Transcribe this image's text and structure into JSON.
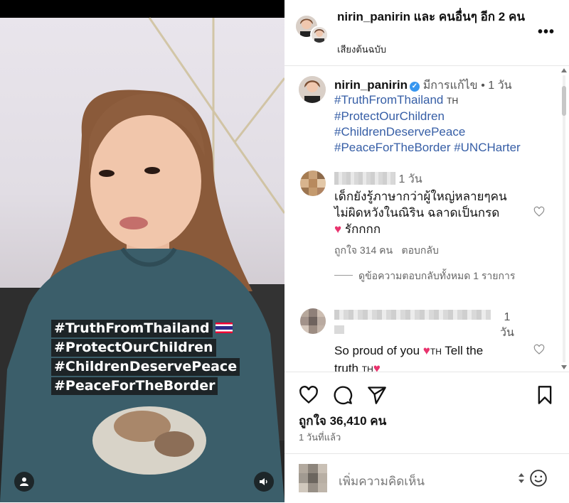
{
  "video": {
    "hashtags": [
      "#TruthFromThailand",
      "#ProtectOurChildren",
      "#ChildrenDeservePeace",
      "#PeaceForTheBorder"
    ],
    "flag_icon": "thailand-flag-icon"
  },
  "header": {
    "title": "nirin_panirin และ คนอื่นๆ อีก 2 คน",
    "audio": "เสียงต้นฉบับ",
    "more_icon": "more-icon"
  },
  "caption": {
    "username": "nirin_panirin",
    "edited": "มีการแก้ไข",
    "time": "1 วัน",
    "lines": [
      {
        "text": "#TruthFromThailand",
        "suffix": "TH"
      },
      {
        "text": "#ProtectOurChildren",
        "suffix": ""
      },
      {
        "text": "#ChildrenDeservePeace",
        "suffix": ""
      },
      {
        "text": "#PeaceForTheBorder #UNCHarter",
        "suffix": ""
      }
    ]
  },
  "comments": [
    {
      "time": "1 วัน",
      "text_lines": [
        "เด็กยังรู้ภาษากว่าผู้ใหญ่หลายๆคน",
        "ไม่ผิดหวังในณิริน ฉลาดเป็นกรด",
        "รักกกก"
      ],
      "likes": "ถูกใจ 314 คน",
      "reply": "ตอบกลับ",
      "view_replies": "ดูข้อความตอบกลับทั้งหมด 1 รายการ"
    },
    {
      "time_num": "1",
      "time_unit": "วัน",
      "text_a": "So proud of you",
      "th1": "TH",
      "text_b": "Tell the",
      "text_c": "truth",
      "th2": "TH"
    }
  ],
  "likes_count": "ถูกใจ 36,410 คน",
  "posted": "1 วันที่แล้ว",
  "add_comment_placeholder": "เพิ่มความคิดเห็น",
  "colors": {
    "hashtag": "#365ea6",
    "verified": "#3897f0",
    "heart": "#e8336d"
  }
}
